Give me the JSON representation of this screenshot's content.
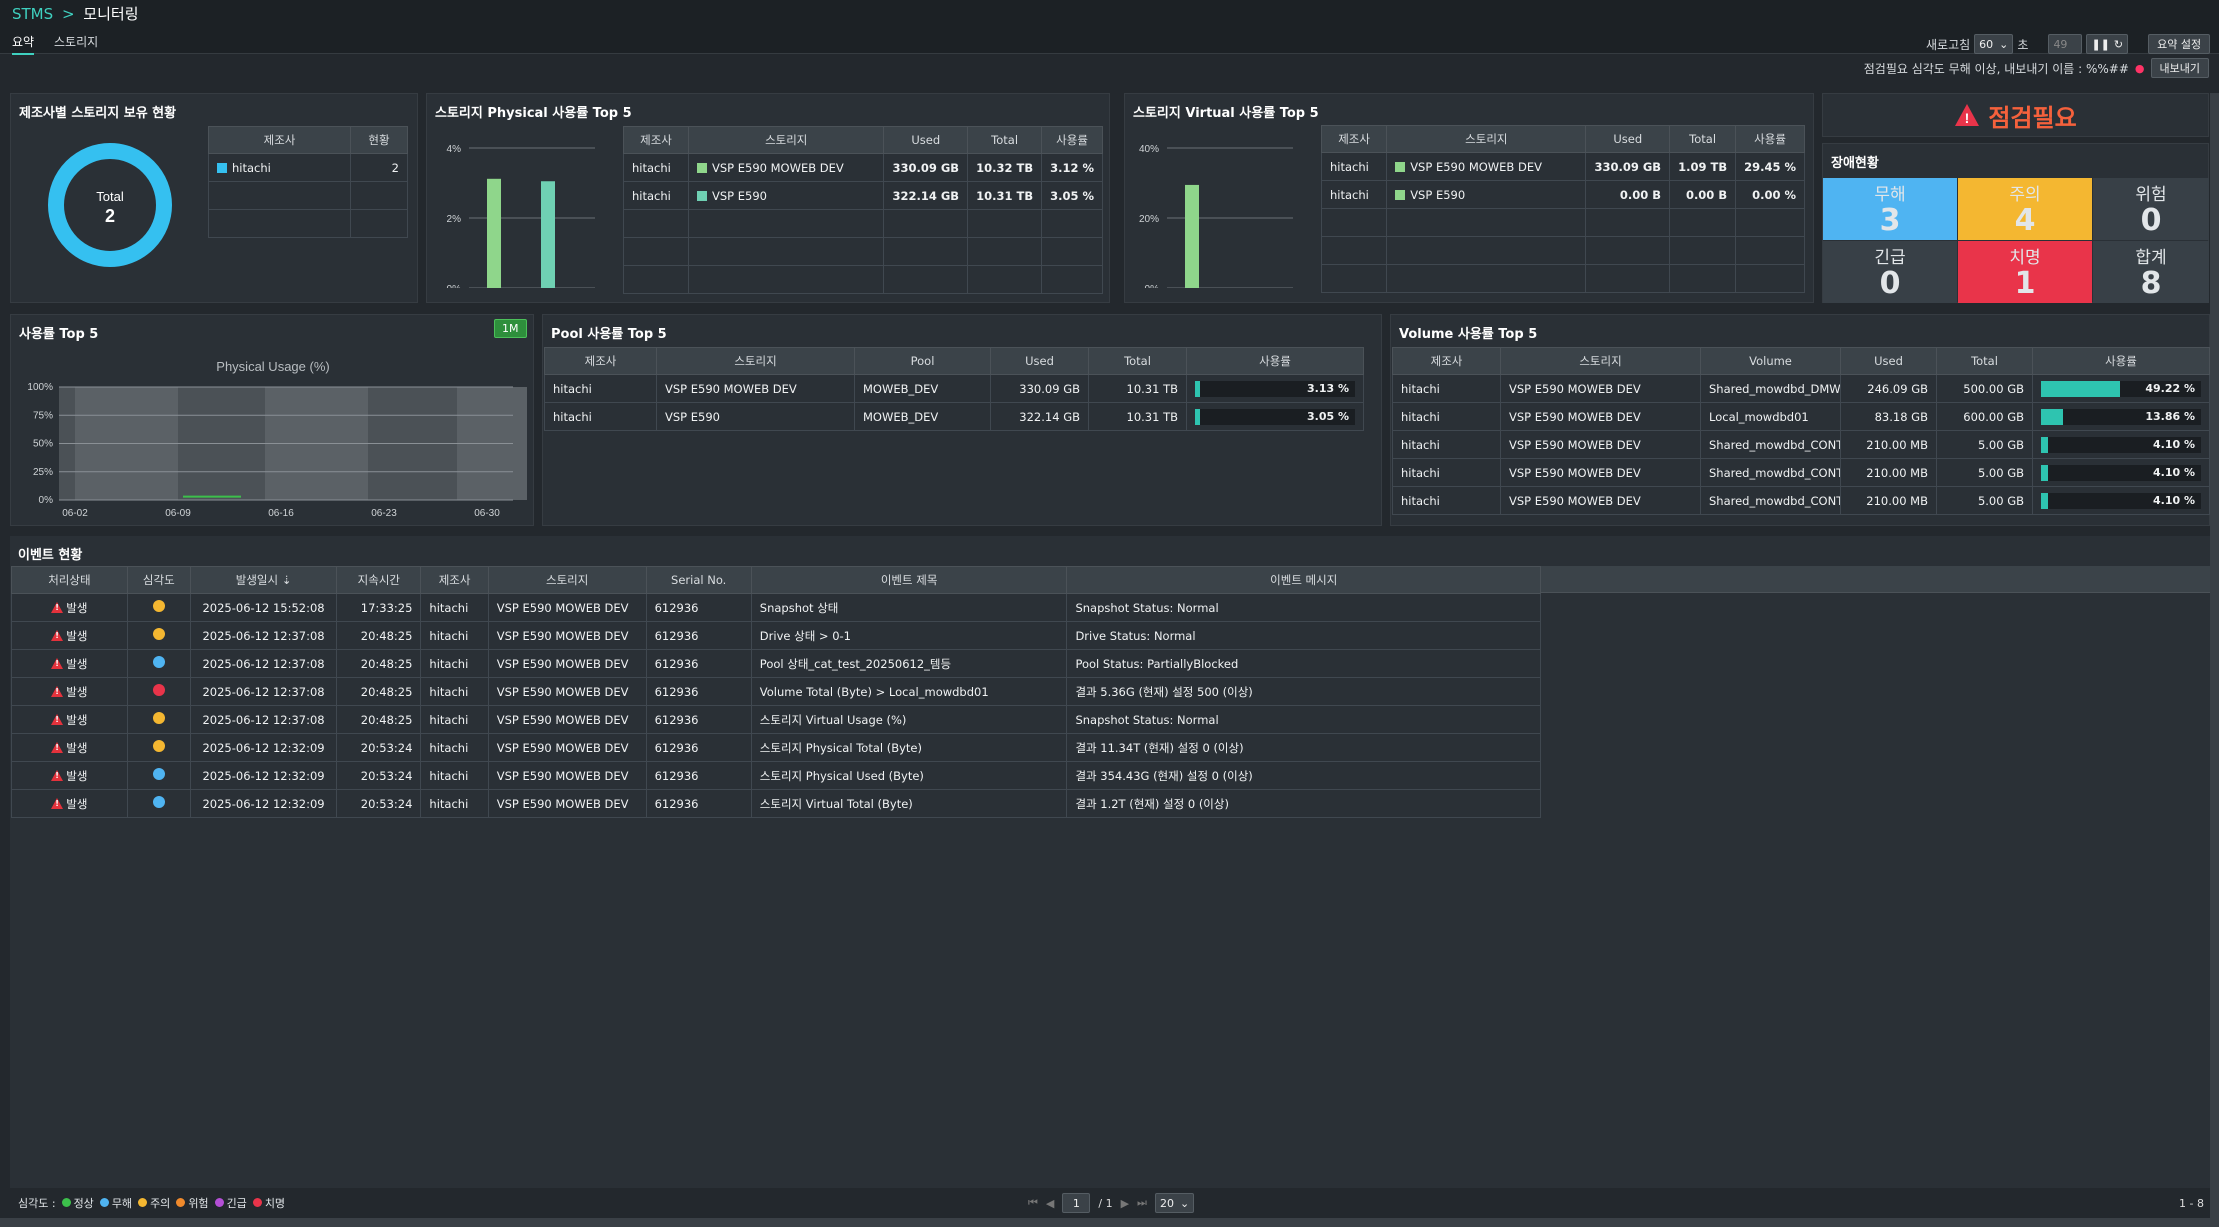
{
  "header": {
    "app": "STMS",
    "separator": ">",
    "page": "모니터링"
  },
  "tabs": [
    {
      "label": "요약",
      "active": true
    },
    {
      "label": "스토리지",
      "active": false
    }
  ],
  "controls": {
    "refresh_label": "새로고침",
    "refresh_value": "60",
    "refresh_unit": "초",
    "countdown": "49",
    "summary_settings": "요약 설정",
    "export_info": "점검필요 심각도 무해 이상, 내보내기 이름 : %%##",
    "export_button": "내보내기"
  },
  "vendor_panel": {
    "title": "제조사별 스토리지 보유 현황",
    "total_label": "Total",
    "total_value": "2",
    "headers": [
      "제조사",
      "현황"
    ],
    "rows": [
      {
        "vendor": "hitachi",
        "count": "2",
        "color": "#35c0f0"
      }
    ]
  },
  "phys_panel": {
    "title": "스토리지 Physical 사용률 Top 5",
    "headers": [
      "제조사",
      "스토리지",
      "Used",
      "Total",
      "사용률"
    ],
    "rows": [
      {
        "vendor": "hitachi",
        "storage": "VSP E590 MOWEB DEV",
        "used": "330.09 GB",
        "total": "10.32 TB",
        "rate": "3.12 %",
        "color": "#8fd68b"
      },
      {
        "vendor": "hitachi",
        "storage": "VSP E590",
        "used": "322.14 GB",
        "total": "10.31 TB",
        "rate": "3.05 %",
        "color": "#6fd0b3"
      }
    ]
  },
  "virt_panel": {
    "title": "스토리지 Virtual 사용률 Top 5",
    "headers": [
      "제조사",
      "스토리지",
      "Used",
      "Total",
      "사용률"
    ],
    "rows": [
      {
        "vendor": "hitachi",
        "storage": "VSP E590 MOWEB DEV",
        "used": "330.09 GB",
        "total": "1.09 TB",
        "rate": "29.45 %",
        "color": "#8fd68b"
      },
      {
        "vendor": "hitachi",
        "storage": "VSP E590",
        "used": "0.00 B",
        "total": "0.00 B",
        "rate": "0.00 %",
        "color": "#8fd68b"
      }
    ]
  },
  "status_panel": {
    "alert": "점검필요",
    "title": "장애현황",
    "cells": [
      {
        "label": "무해",
        "value": "3",
        "bg": "#4fb4f2"
      },
      {
        "label": "주의",
        "value": "4",
        "bg": "#f4b731"
      },
      {
        "label": "위험",
        "value": "0",
        "bg": "#384047"
      },
      {
        "label": "긴급",
        "value": "0",
        "bg": "#384047"
      },
      {
        "label": "치명",
        "value": "1",
        "bg": "#e9344a"
      },
      {
        "label": "합계",
        "value": "8",
        "bg": "#384047"
      }
    ]
  },
  "usage_panel": {
    "title": "사용률 Top 5",
    "period": "1M",
    "chart_title": "Physical Usage (%)"
  },
  "pool_panel": {
    "title": "Pool 사용률 Top 5",
    "headers": [
      "제조사",
      "스토리지",
      "Pool",
      "Used",
      "Total",
      "사용률"
    ],
    "rows": [
      {
        "vendor": "hitachi",
        "storage": "VSP E590 MOWEB DEV",
        "pool": "MOWEB_DEV",
        "used": "330.09 GB",
        "total": "10.31 TB",
        "rate": "3.13 %",
        "pct": 3.13
      },
      {
        "vendor": "hitachi",
        "storage": "VSP E590",
        "pool": "MOWEB_DEV",
        "used": "322.14 GB",
        "total": "10.31 TB",
        "rate": "3.05 %",
        "pct": 3.05
      }
    ]
  },
  "volume_panel": {
    "title": "Volume 사용률 Top 5",
    "headers": [
      "제조사",
      "스토리지",
      "Volume",
      "Used",
      "Total",
      "사용률"
    ],
    "rows": [
      {
        "vendor": "hitachi",
        "storage": "VSP E590 MOWEB DEV",
        "volume": "Shared_mowdbd_DMWB",
        "used": "246.09 GB",
        "total": "500.00 GB",
        "rate": "49.22 %",
        "pct": 49.22
      },
      {
        "vendor": "hitachi",
        "storage": "VSP E590 MOWEB DEV",
        "volume": "Local_mowdbd01",
        "used": "83.18 GB",
        "total": "600.00 GB",
        "rate": "13.86 %",
        "pct": 13.86
      },
      {
        "vendor": "hitachi",
        "storage": "VSP E590 MOWEB DEV",
        "volume": "Shared_mowdbd_CONTRC",
        "used": "210.00 MB",
        "total": "5.00 GB",
        "rate": "4.10 %",
        "pct": 4.1
      },
      {
        "vendor": "hitachi",
        "storage": "VSP E590 MOWEB DEV",
        "volume": "Shared_mowdbd_CONTRC",
        "used": "210.00 MB",
        "total": "5.00 GB",
        "rate": "4.10 %",
        "pct": 4.1
      },
      {
        "vendor": "hitachi",
        "storage": "VSP E590 MOWEB DEV",
        "volume": "Shared_mowdbd_CONTRC",
        "used": "210.00 MB",
        "total": "5.00 GB",
        "rate": "4.10 %",
        "pct": 4.1
      }
    ]
  },
  "events_panel": {
    "title": "이벤트 현황",
    "headers": [
      "처리상태",
      "심각도",
      "발생일시 ⇣",
      "지속시간",
      "제조사",
      "스토리지",
      "Serial No.",
      "이벤트 제목",
      "이벤트 메시지"
    ],
    "rows": [
      {
        "state": "발생",
        "sev": "#f4b731",
        "time": "2025-06-12 15:52:08",
        "dur": "17:33:25",
        "vendor": "hitachi",
        "storage": "VSP E590 MOWEB DEV",
        "serial": "612936",
        "subject": "Snapshot 상태",
        "message": "Snapshot Status: Normal"
      },
      {
        "state": "발생",
        "sev": "#f4b731",
        "time": "2025-06-12 12:37:08",
        "dur": "20:48:25",
        "vendor": "hitachi",
        "storage": "VSP E590 MOWEB DEV",
        "serial": "612936",
        "subject": "Drive 상태 > 0-1",
        "message": "Drive Status: Normal"
      },
      {
        "state": "발생",
        "sev": "#4fb4f2",
        "time": "2025-06-12 12:37:08",
        "dur": "20:48:25",
        "vendor": "hitachi",
        "storage": "VSP E590 MOWEB DEV",
        "serial": "612936",
        "subject": "Pool 상태_cat_test_20250612_템등",
        "message": "Pool Status: PartiallyBlocked"
      },
      {
        "state": "발생",
        "sev": "#e9344a",
        "time": "2025-06-12 12:37:08",
        "dur": "20:48:25",
        "vendor": "hitachi",
        "storage": "VSP E590 MOWEB DEV",
        "serial": "612936",
        "subject": "Volume Total (Byte) > Local_mowdbd01",
        "message": "결과 5.36G (현재) 설정 500 (이상)"
      },
      {
        "state": "발생",
        "sev": "#f4b731",
        "time": "2025-06-12 12:37:08",
        "dur": "20:48:25",
        "vendor": "hitachi",
        "storage": "VSP E590 MOWEB DEV",
        "serial": "612936",
        "subject": "스토리지 Virtual Usage (%)",
        "message": "Snapshot Status: Normal"
      },
      {
        "state": "발생",
        "sev": "#f4b731",
        "time": "2025-06-12 12:32:09",
        "dur": "20:53:24",
        "vendor": "hitachi",
        "storage": "VSP E590 MOWEB DEV",
        "serial": "612936",
        "subject": "스토리지 Physical Total (Byte)",
        "message": "결과 11.34T (현재) 설정 0 (이상)"
      },
      {
        "state": "발생",
        "sev": "#4fb4f2",
        "time": "2025-06-12 12:32:09",
        "dur": "20:53:24",
        "vendor": "hitachi",
        "storage": "VSP E590 MOWEB DEV",
        "serial": "612936",
        "subject": "스토리지 Physical Used (Byte)",
        "message": "결과 354.43G (현재) 설정 0 (이상)"
      },
      {
        "state": "발생",
        "sev": "#4fb4f2",
        "time": "2025-06-12 12:32:09",
        "dur": "20:53:24",
        "vendor": "hitachi",
        "storage": "VSP E590 MOWEB DEV",
        "serial": "612936",
        "subject": "스토리지 Virtual Total (Byte)",
        "message": "결과 1.2T (현재) 설정 0 (이상)"
      }
    ]
  },
  "footer": {
    "legend_label": "심각도 :",
    "legend": [
      {
        "label": "정상",
        "color": "#3cc04b"
      },
      {
        "label": "무해",
        "color": "#4fb4f2"
      },
      {
        "label": "주의",
        "color": "#f4b731"
      },
      {
        "label": "위험",
        "color": "#f08a2c"
      },
      {
        "label": "긴급",
        "color": "#b44fd6"
      },
      {
        "label": "치명",
        "color": "#e9344a"
      }
    ],
    "page": "1",
    "page_total": "/ 1",
    "page_size": "20",
    "range": "1 - 8"
  },
  "chart_data": [
    {
      "type": "bar",
      "title": "",
      "categories": [
        "VSP E590 MOWEB DEV",
        "VSP E590"
      ],
      "values": [
        3.12,
        3.05
      ],
      "ylim": [
        0,
        4
      ],
      "yticks": [
        "0%",
        "2%",
        "4%"
      ],
      "grid": true
    },
    {
      "type": "bar",
      "title": "",
      "categories": [
        "VSP E590 MOWEB DEV",
        "VSP E590"
      ],
      "values": [
        29.45,
        0.0
      ],
      "ylim": [
        0,
        40
      ],
      "yticks": [
        "0%",
        "20%",
        "40%"
      ],
      "grid": true
    },
    {
      "type": "line",
      "title": "Physical Usage (%)",
      "x": [
        "06-02",
        "06-09",
        "06-16",
        "06-23",
        "06-30"
      ],
      "ylim": [
        0,
        100
      ],
      "yticks": [
        "0%",
        "25%",
        "50%",
        "75%",
        "100%"
      ],
      "series": [
        {
          "values": [
            3,
            3
          ]
        }
      ],
      "grid": true
    }
  ]
}
